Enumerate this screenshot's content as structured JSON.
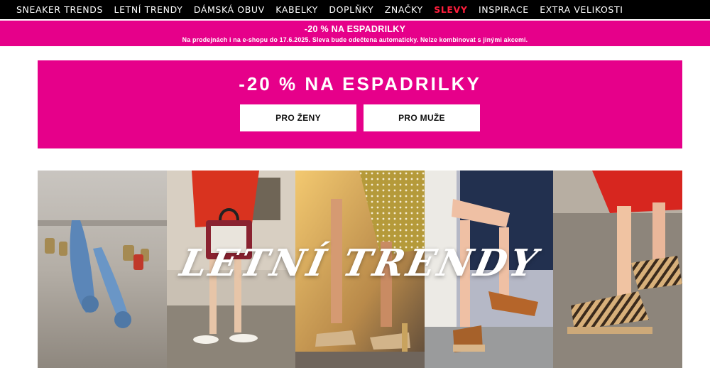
{
  "nav": {
    "items": [
      {
        "label": "SNEAKER TRENDS",
        "highlight": false
      },
      {
        "label": "LETNÍ TRENDY",
        "highlight": false
      },
      {
        "label": "DÁMSKÁ OBUV",
        "highlight": false
      },
      {
        "label": "KABELKY",
        "highlight": false
      },
      {
        "label": "DOPLŇKY",
        "highlight": false
      },
      {
        "label": "ZNAČKY",
        "highlight": false
      },
      {
        "label": "SLEVY",
        "highlight": true
      },
      {
        "label": "INSPIRACE",
        "highlight": false
      },
      {
        "label": "EXTRA VELIKOSTI",
        "highlight": false
      }
    ]
  },
  "promo_strip": {
    "title": "-20 % NA ESPADRILKY",
    "note": "Na prodejnách i na e-shopu do 17.6.2025. Sleva bude odečtena automaticky. Nelze kombinovat s jinými akcemi."
  },
  "hero": {
    "title": "-20 % NA ESPADRILKY",
    "button_women": "PRO ŽENY",
    "button_men": "PRO MUŽE"
  },
  "banner": {
    "overlay_text": "LETNÍ TRENDY"
  },
  "colors": {
    "brand_pink": "#e6008a",
    "nav_bg": "#000000",
    "sale_red": "#ff1e3c"
  }
}
